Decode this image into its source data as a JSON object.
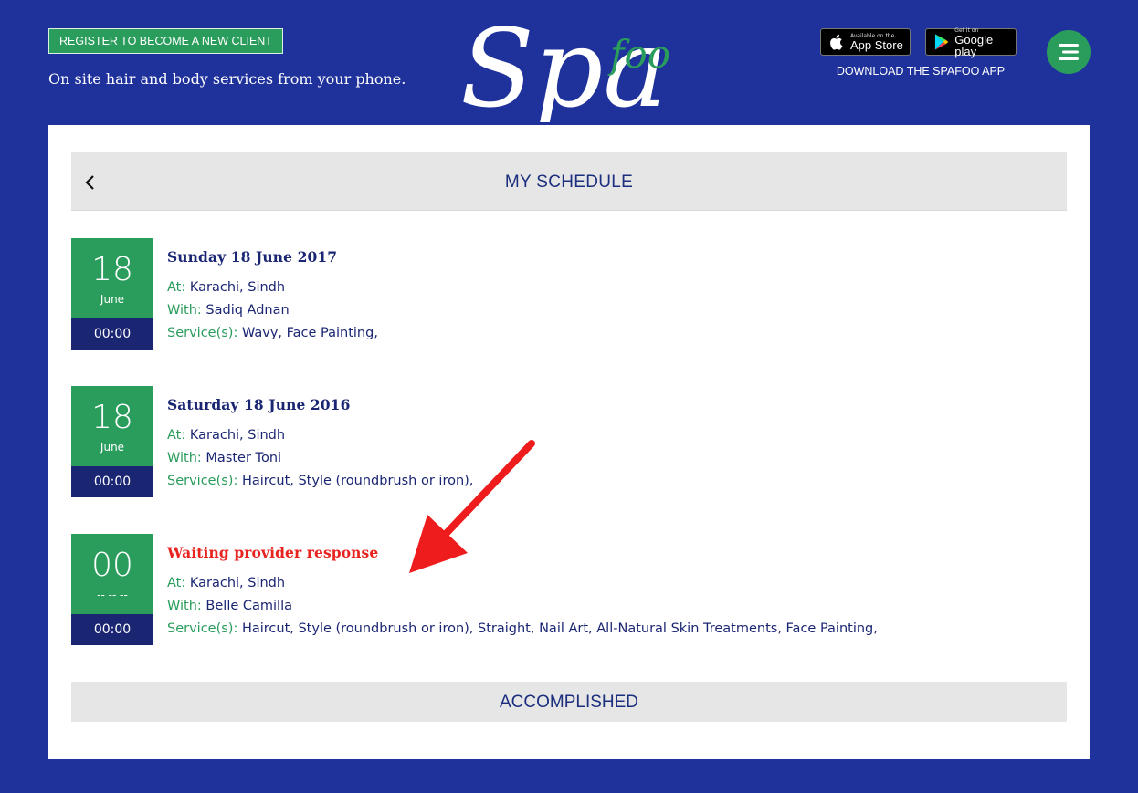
{
  "header": {
    "register_label": "REGISTER TO BECOME A NEW CLIENT",
    "tagline": "On site hair and body services from your phone.",
    "logo_text_main": "Spa",
    "logo_text_sub": "foo",
    "app_store": {
      "small": "Available on the",
      "big": "App Store"
    },
    "google_play": {
      "small": "Get it on",
      "big": "Google play"
    },
    "download_label": "DOWNLOAD THE SPAFOO APP",
    "menu_icon": "hamburger-menu-icon"
  },
  "schedule": {
    "title": "MY SCHEDULE",
    "back_icon": "chevron-left-icon",
    "labels": {
      "at": "At:",
      "with": "With:",
      "services": "Service(s):"
    },
    "appointments": [
      {
        "day": "18",
        "month": "June",
        "time": "00:00",
        "title": "Sunday 18 June 2017",
        "location": "Karachi, Sindh",
        "provider": "Sadiq Adnan",
        "services": "Wavy,  Face Painting,"
      },
      {
        "day": "18",
        "month": "June",
        "time": "00:00",
        "title": "Saturday 18 June 2016",
        "location": "Karachi, Sindh",
        "provider": "Master Toni",
        "services": "Haircut,  Style (roundbrush or iron),"
      },
      {
        "day": "00",
        "month": "-- -- --",
        "time": "00:00",
        "title": "Waiting provider response",
        "location": "Karachi, Sindh",
        "provider": "Belle Camilla",
        "services": "Haircut,  Style (roundbrush or iron),  Straight,  Nail Art,  All-Natural Skin Treatments,  Face Painting,"
      }
    ],
    "accomplished_label": "ACCOMPLISHED"
  },
  "colors": {
    "background": "#1f319b",
    "accent_green": "#2a9d5c",
    "navy": "#1b2673",
    "pending_red": "#e8231f",
    "annotation_arrow": "#ee1c1c"
  }
}
